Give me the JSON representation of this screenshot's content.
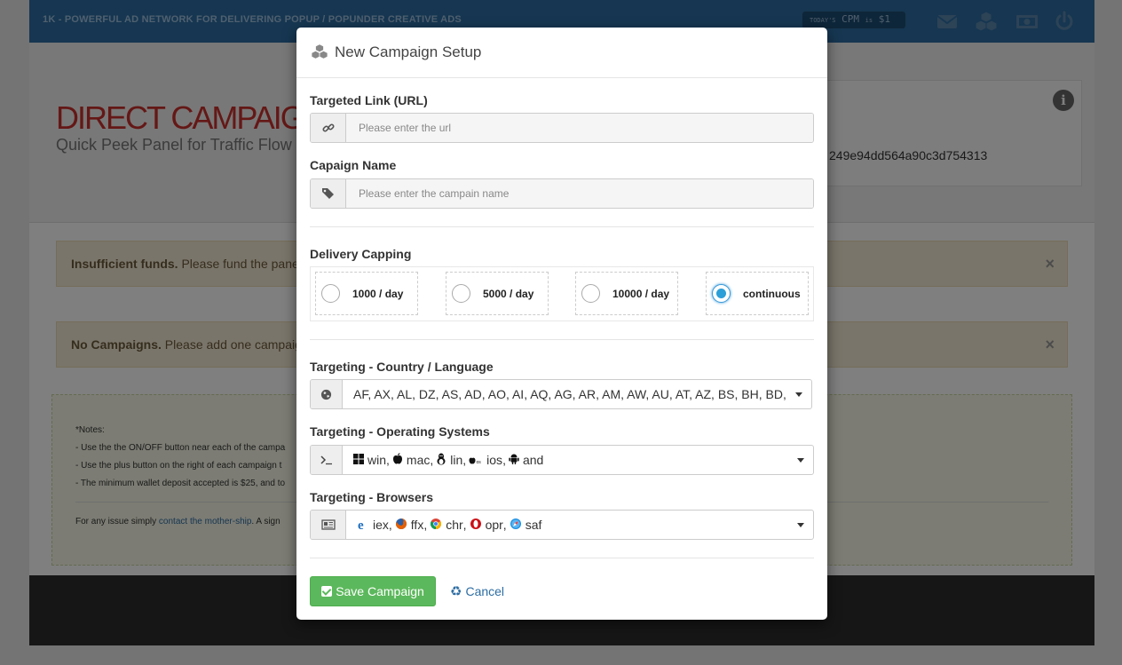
{
  "topbar": {
    "brand": "1K - POWERFUL AD NETWORK FOR DELIVERING POPUP / POPUNDER CREATIVE ADS",
    "cpm_prefix": "TODAY'S",
    "cpm_label": "CPM",
    "cpm_is": "is",
    "cpm_value": "$1",
    "icons": [
      "envelope-icon",
      "cubes-icon",
      "money-icon",
      "power-icon"
    ]
  },
  "header": {
    "title": "DIRECT CAMPAIGN",
    "subtitle": "Quick Peek Panel for Traffic Flow t",
    "hash": "249e94dd564a90c3d754313"
  },
  "alerts": [
    {
      "strong": "Insufficient funds.",
      "text": " Please fund the panel´s"
    },
    {
      "strong": "No Campaigns.",
      "text": " Please add one campaign"
    }
  ],
  "notes": {
    "heading": "*Notes:",
    "lines": [
      "- Use the the ON/OFF button near each of the campa",
      "- Use the plus button on the right of each campaign t",
      "- The minimum wallet deposit accepted is $25, and to"
    ],
    "footer_prefix": "For any issue simply ",
    "footer_link": "contact the mother-ship",
    "footer_suffix": ". A sign"
  },
  "modal": {
    "title": "New Campaign Setup",
    "url": {
      "label": "Targeted Link (URL)",
      "placeholder": "Please enter the url",
      "value": ""
    },
    "name": {
      "label": "Capaign Name",
      "placeholder": "Please enter the campain name",
      "value": ""
    },
    "capping": {
      "label": "Delivery Capping",
      "options": [
        {
          "label": "1000 / day",
          "selected": false
        },
        {
          "label": "5000 / day",
          "selected": false
        },
        {
          "label": "10000 / day",
          "selected": false
        },
        {
          "label": "continuous",
          "selected": true
        }
      ]
    },
    "country": {
      "label": "Targeting - Country / Language",
      "value": "AF, AX, AL, DZ, AS, AD, AO, AI, AQ, AG, AR, AM, AW, AU, AT, AZ, BS, BH, BD,"
    },
    "os": {
      "label": "Targeting - Operating Systems",
      "items": [
        {
          "name": "win",
          "icon": "windows-icon",
          "sep": ","
        },
        {
          "name": "mac",
          "icon": "apple-icon",
          "sep": ","
        },
        {
          "name": "lin",
          "icon": "linux-icon",
          "sep": ","
        },
        {
          "name": "ios",
          "icon": "ios-icon",
          "sep": ","
        },
        {
          "name": "and",
          "icon": "android-icon",
          "sep": ""
        }
      ]
    },
    "browsers": {
      "label": "Targeting - Browsers",
      "items": [
        {
          "name": "iex",
          "icon": "ie-icon",
          "sep": ","
        },
        {
          "name": "ffx",
          "icon": "firefox-icon",
          "sep": ","
        },
        {
          "name": "chr",
          "icon": "chrome-icon",
          "sep": ","
        },
        {
          "name": "opr",
          "icon": "opera-icon",
          "sep": ","
        },
        {
          "name": "saf",
          "icon": "safari-icon",
          "sep": ""
        }
      ]
    },
    "save_label": "Save Campaign",
    "cancel_label": "Cancel"
  },
  "colors": {
    "topbar": "#2d6da3",
    "title_red": "#c9302c",
    "save_green": "#5cb85c",
    "radio_blue": "#2a9fd8"
  }
}
